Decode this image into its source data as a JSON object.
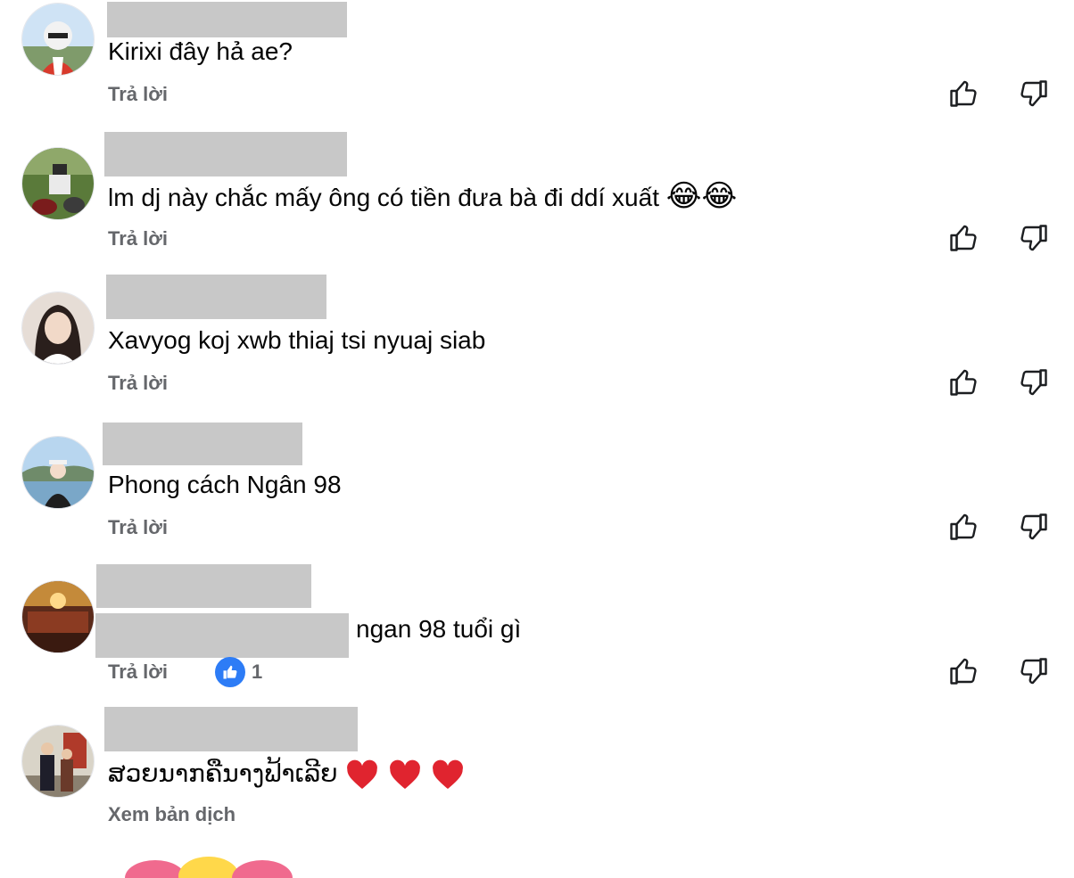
{
  "comments": [
    {
      "text": "Kirixi đây hả ae?",
      "reply": "Trả lời",
      "avatar": "avatar-biker"
    },
    {
      "text": "lm dj này chắc mấy ông có tiền đưa bà đi ddí xuất",
      "emoji": "😂😂",
      "reply": "Trả lời",
      "avatar": "avatar-motorbike"
    },
    {
      "text": "Xavyog koj xwb thiaj tsi nyuaj siab",
      "reply": "Trả lời",
      "avatar": "avatar-woman"
    },
    {
      "text": "Phong cách Ngân 98",
      "reply": "Trả lời",
      "avatar": "avatar-lake"
    },
    {
      "text": "ngan 98 tuổi gì",
      "reply": "Trả lời",
      "like_count": "1",
      "avatar": "avatar-hall"
    },
    {
      "text": "ສວຍນາກຄືນາງຟ້າເລີຍ",
      "reply": "Xem bản dịch",
      "avatar": "avatar-couple"
    }
  ],
  "icons": {
    "like": "thumbs-up-outline-icon",
    "dislike": "thumbs-down-outline-icon",
    "like_badge": "like-reaction-icon",
    "heart": "red-heart-icon"
  },
  "colors": {
    "text": "#050505",
    "secondary": "#65676b",
    "redacted": "#c8c8c8",
    "like_blue": "#2d7cf6",
    "heart_red": "#e0242f"
  }
}
